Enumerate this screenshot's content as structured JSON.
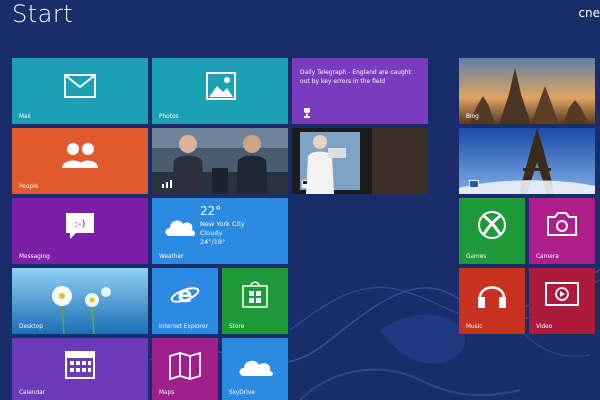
{
  "header": {
    "title": "Start",
    "user": "cne"
  },
  "tiles": {
    "mail": "Mail",
    "photos": "Photos",
    "people": "People",
    "messaging": "Messaging",
    "weather": {
      "label": "Weather",
      "temp": "22°",
      "city": "New York City",
      "condition": "Cloudy",
      "range": "24°/19°"
    },
    "desktop": "Desktop",
    "ie": "Internet Explorer",
    "store": "Store",
    "calendar": "Calendar",
    "maps": "Maps",
    "skydrive": "SkyDrive",
    "news_headline": "Daily Telegraph - England are caught out by key errors in the field",
    "blog": "Blog",
    "games": "Games",
    "camera": "Camera",
    "music": "Music",
    "video": "Video"
  },
  "colors": {
    "background": "#1a2d6b",
    "teal": "#1ba1b4",
    "orange": "#e05a2b",
    "purple": "#7d1ea6",
    "blue": "#2b8ae2",
    "green": "#1e9a3a",
    "violet": "#6b3ab8",
    "magenta": "#b01e8c",
    "red": "#c8311f",
    "crimson": "#ad1a3c"
  }
}
